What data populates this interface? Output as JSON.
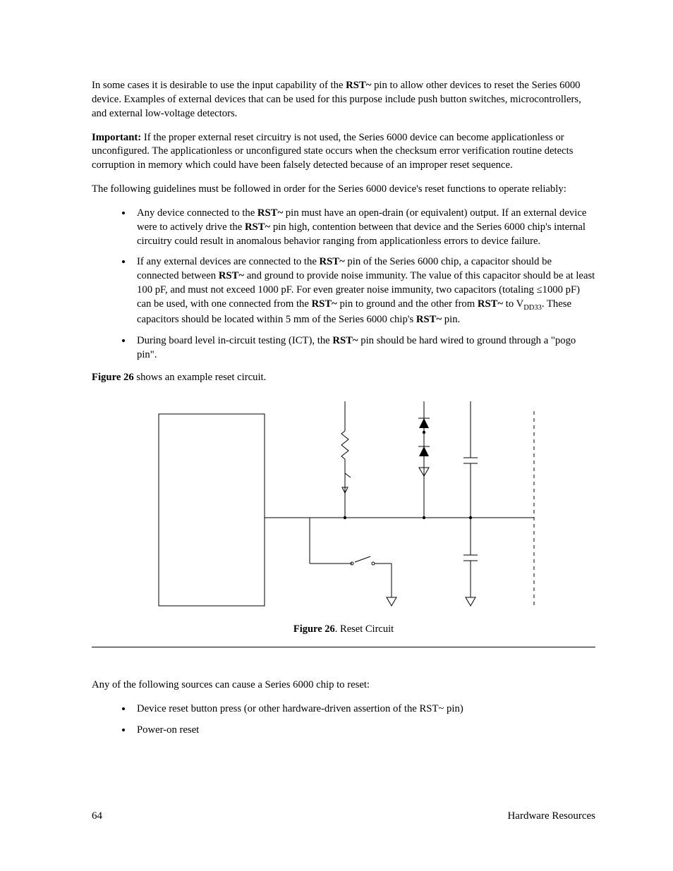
{
  "p1": {
    "pre": "In some cases it is desirable to use the input capability of the ",
    "rst": "RST~",
    "post": " pin to allow other devices to reset the Series 6000 device.  Examples of external devices that can be used for this purpose include push button switches, microcontrollers, and external low-voltage detectors."
  },
  "p2": {
    "label": "Important:",
    "body": "  If the proper external reset circuitry is not used, the Series 6000 device can become applicationless or unconfigured.  The applicationless or unconfigured state occurs when the checksum error verification routine detects corruption in memory which could have been falsely detected because of an improper reset sequence."
  },
  "p3": "The following guidelines must be followed in order for the Series 6000 device's reset functions to operate reliably:",
  "bul1": {
    "a": "Any device connected to the ",
    "rst1": "RST~",
    "b": " pin must have an open-drain (or equivalent) output.  If an external device were to actively drive the ",
    "rst2": "RST~",
    "c": " pin high, contention between that device and the Series 6000 chip's internal circuitry could result in anomalous behavior ranging from applicationless errors to device failure."
  },
  "bul2": {
    "a": "If any external devices are connected to the ",
    "rst1": "RST~",
    "b": " pin of the Series 6000 chip, a capacitor should be connected between ",
    "rst2": "RST~",
    "c": " and ground to provide noise immunity.  The value of this capacitor should be at least 100 pF, and must not exceed 1000 pF.  For even greater noise immunity, two capacitors (totaling ≤1000 pF) can be used, with one connected from the ",
    "rst3": "RST~",
    "d": " pin to ground and the other from ",
    "rst4": "RST~",
    "e": " to V",
    "sub": "DD33",
    "f": ".  These capacitors should be located within 5 mm of the Series 6000 chip's ",
    "rst5": "RST~",
    "g": " pin."
  },
  "bul3": {
    "a": "During board level in-circuit testing (ICT), the ",
    "rst1": "RST~",
    "b": " pin should be hard wired to ground through a \"pogo pin\"."
  },
  "p4": {
    "label": "Figure 26",
    "body": " shows an example reset circuit."
  },
  "figcap": {
    "label": "Figure 26",
    "body": ". Reset Circuit"
  },
  "p5": "Any of the following sources can cause a Series 6000 chip to reset:",
  "bul4": "Device reset button press (or other hardware-driven assertion of the RST~ pin)",
  "bul5": "Power-on reset",
  "footer": {
    "page": "64",
    "title": "Hardware Resources"
  }
}
